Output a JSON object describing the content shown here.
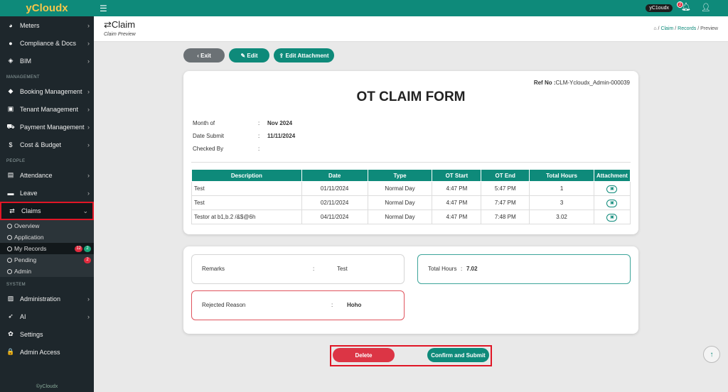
{
  "brand": "yCloudx",
  "sidebar": {
    "top_items": [
      {
        "icon": "gauge-icon",
        "glyph": "◕",
        "label": "Meters"
      },
      {
        "icon": "circle-icon",
        "glyph": "●",
        "label": "Compliance & Docs"
      },
      {
        "icon": "cube-icon",
        "glyph": "◈",
        "label": "BIM"
      }
    ],
    "section_management": "MANAGEMENT",
    "management_items": [
      {
        "icon": "tag-icon",
        "glyph": "◆",
        "label": "Booking Management"
      },
      {
        "icon": "building-icon",
        "glyph": "▣",
        "label": "Tenant Management"
      },
      {
        "icon": "cart-icon",
        "glyph": "⛟",
        "label": "Payment Management"
      },
      {
        "icon": "dollar-icon",
        "glyph": "$",
        "label": "Cost & Budget"
      }
    ],
    "section_people": "PEOPLE",
    "people_items": [
      {
        "icon": "clipboard-icon",
        "glyph": "▤",
        "label": "Attendance"
      },
      {
        "icon": "briefcase-icon",
        "glyph": "▬",
        "label": "Leave"
      }
    ],
    "claims_label": "Claims",
    "claims_sub": [
      {
        "label": "Overview"
      },
      {
        "label": "Application"
      },
      {
        "label": "My Records",
        "badge_red": "12",
        "badge_green": "2"
      },
      {
        "label": "Pending",
        "badge_red": "2"
      },
      {
        "label": "Admin"
      }
    ],
    "section_system": "SYSTEM",
    "system_items": [
      {
        "icon": "admin-icon",
        "glyph": "▨",
        "label": "Administration",
        "chev": true
      },
      {
        "icon": "rocket-icon",
        "glyph": "➶",
        "label": "AI",
        "chev": true
      },
      {
        "icon": "gear-icon",
        "glyph": "✿",
        "label": "Settings",
        "chev": false
      },
      {
        "icon": "lock-icon",
        "glyph": "🔒",
        "label": "Admin Access",
        "chev": false
      }
    ],
    "footer": "©yCloudx"
  },
  "topbar": {
    "user": "yC1oudx",
    "notif_count": "2"
  },
  "header": {
    "title": "Claim",
    "subtitle": "Claim Preview",
    "breadcrumb": [
      "Claim",
      "Records",
      "Preview"
    ]
  },
  "actions": {
    "exit": "Exit",
    "edit": "Edit",
    "edit_attachment": "Edit Attachment"
  },
  "form": {
    "ref_label": "Ref No :",
    "ref_value": "CLM-Ycloudx_Admin-000039",
    "title": "OT CLAIM FORM",
    "month_label": "Month of",
    "month_value": "Nov 2024",
    "date_label": "Date Submit",
    "date_value": "11/11/2024",
    "checked_label": "Checked By",
    "checked_value": "",
    "columns": [
      "Description",
      "Date",
      "Type",
      "OT Start",
      "OT End",
      "Total Hours",
      "Attachment"
    ],
    "rows": [
      {
        "desc": "Test",
        "date": "01/11/2024",
        "type": "Normal Day",
        "start": "4:47 PM",
        "end": "5:47 PM",
        "hours": "1"
      },
      {
        "desc": "Test",
        "date": "02/11/2024",
        "type": "Normal Day",
        "start": "4:47 PM",
        "end": "7:47 PM",
        "hours": "3"
      },
      {
        "desc": "Testor at b1,b.2 /&$@6h",
        "date": "04/11/2024",
        "type": "Normal Day",
        "start": "4:47 PM",
        "end": "7:48 PM",
        "hours": "3.02"
      }
    ]
  },
  "summary": {
    "remarks_label": "Remarks",
    "remarks_value": "Test",
    "total_label": "Total Hours",
    "total_value": "7.02",
    "rejected_label": "Rejected Reason",
    "rejected_value": "Hoho"
  },
  "bottom": {
    "delete": "Delete",
    "confirm": "Confirm and Submit"
  }
}
